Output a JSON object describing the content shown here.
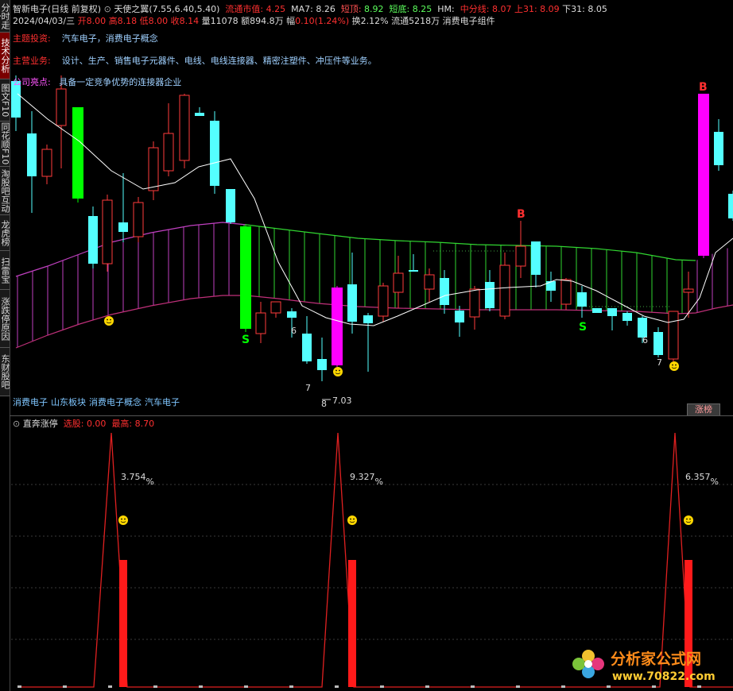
{
  "sidebar": {
    "tabs": [
      {
        "label": "分时走势"
      },
      {
        "label": "技术分析"
      },
      {
        "label": "图文F10"
      },
      {
        "label": "同花顺F10"
      },
      {
        "label": "淘股吧互动"
      },
      {
        "label": "龙虎榜"
      },
      {
        "label": "扫雷宝"
      },
      {
        "label": "涨跌停原因"
      },
      {
        "label": "东财股吧"
      }
    ]
  },
  "header": {
    "stock_name": "智新电子",
    "period": "(日线 前复权)",
    "indicator_name": "天使之翼",
    "indicator_params": "(7.55,6.40,5.40)",
    "liutong_label": "流通市值:",
    "liutong_value": "4.25",
    "ma7_label": "MA7:",
    "ma7_value": "8.26",
    "duanding_label": "短顶:",
    "duanding_value": "8.92",
    "duandi_label": "短底:",
    "duandi_value": "8.25",
    "hm_label": "HM:",
    "zhongfen_label": "中分线:",
    "zhongfen_value": "8.07",
    "shang31_label": "上31:",
    "shang31_value": "8.09",
    "xia31_label": "下31:",
    "xia31_value": "8.05"
  },
  "quote": {
    "date": "2024/04/03/三",
    "open_label": "开",
    "open_value": "8.00",
    "high_label": "高",
    "high_value": "8.18",
    "low_label": "低",
    "low_value": "8.00",
    "close_label": "收",
    "close_value": "8.14",
    "vol_label": "量",
    "vol_value": "11078",
    "amount_label": "额",
    "amount_value": "894.8万",
    "change_label": "幅",
    "change_value": "0.10(1.24%)",
    "turnover_label": "换",
    "turnover_value": "2.12%",
    "float_label": "流通",
    "float_value": "5218万",
    "concept": "消费电子组件"
  },
  "info": {
    "theme_label": "主题投资:",
    "theme_text": "汽车电子，消费电子概念",
    "business_label": "主营业务:",
    "business_text": "设计、生产、销售电子元器件、电线、电线连接器、精密注塑件、冲压件等业务。",
    "highlight_label": "公司亮点:",
    "highlight_text": "具备一定竞争优势的连接器企业"
  },
  "board_tags": [
    "消费电子",
    "山东板块",
    "消费电子概念",
    "汽车电子"
  ],
  "zhangbang_button": "涨榜",
  "low_price_label": "7.03",
  "signals": {
    "buy": "B",
    "sell": "S"
  },
  "count_labels": [
    "6",
    "7",
    "8",
    "6",
    "7"
  ],
  "sub_indicator": {
    "name": "直奔涨停",
    "xuangu_label": "选股:",
    "xuangu_value": "0.00",
    "zuigao_label": "最高:",
    "zuigao_value": "8.70",
    "peaks": [
      {
        "pct": "3.754",
        "unit": "%"
      },
      {
        "pct": "9.327",
        "unit": "%"
      },
      {
        "pct": "6.357",
        "unit": "%"
      }
    ]
  },
  "watermark": {
    "title": "分析家公式网",
    "url": "www.70822.com"
  },
  "colors": {
    "up": "#ff3b3b",
    "down": "#54ffff",
    "green_band": "#31d631",
    "magenta": "#ff00ff",
    "bright_green": "#00ff00",
    "text_blue": "#9fd0ff",
    "label_red": "#ff3030",
    "smile": "#ffd700"
  }
}
